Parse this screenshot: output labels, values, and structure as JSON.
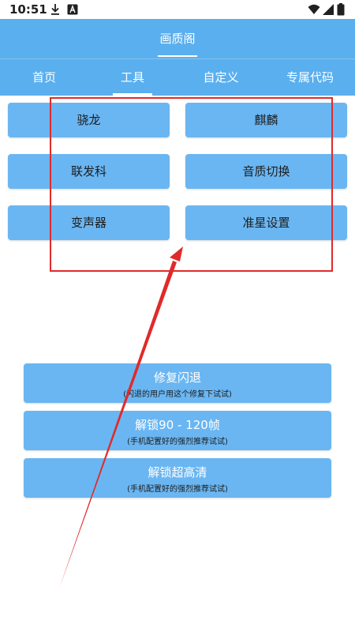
{
  "status_bar": {
    "time": "10:51",
    "icons": [
      "download-icon",
      "font-app-icon",
      "wifi-icon",
      "signal-icon",
      "battery-icon"
    ]
  },
  "app_bar": {
    "title": "画质阁"
  },
  "tabs": [
    {
      "label": "首页"
    },
    {
      "label": "工具"
    },
    {
      "label": "自定义"
    },
    {
      "label": "专属代码"
    }
  ],
  "selected_tab": "工具",
  "tool_buttons": [
    {
      "label": "骁龙"
    },
    {
      "label": "麒麟"
    },
    {
      "label": "联发科"
    },
    {
      "label": "音质切换"
    },
    {
      "label": "变声器"
    },
    {
      "label": "准星设置"
    }
  ],
  "actions": [
    {
      "title": "修复闪退",
      "subtitle": "(闪退的用户用这个修复下试试)"
    },
    {
      "title": "解锁90 - 120帧",
      "subtitle": "(手机配置好的强烈推荐试试)"
    },
    {
      "title": "解锁超高清",
      "subtitle": "(手机配置好的强烈推荐试试)"
    }
  ],
  "colors": {
    "primary": "#5aafef",
    "button": "#6ab6f2",
    "annotation": "#e02a2a"
  }
}
